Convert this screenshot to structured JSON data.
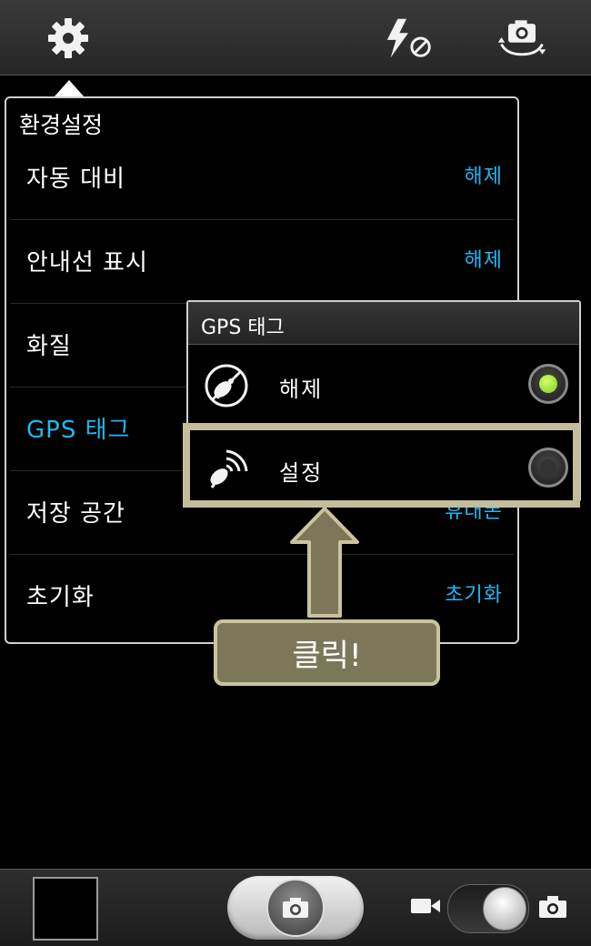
{
  "settings_menu": {
    "title": "환경설정",
    "rows": [
      {
        "label": "자동 대비",
        "value": "해제"
      },
      {
        "label": "안내선 표시",
        "value": "해제"
      },
      {
        "label": "화질",
        "value": ""
      },
      {
        "label": "GPS 태그",
        "value": ""
      },
      {
        "label": "저장 공간",
        "value": "휴대폰"
      },
      {
        "label": "초기화",
        "value": "초기화"
      }
    ]
  },
  "gps_popup": {
    "title": "GPS 태그",
    "options": [
      {
        "label": "해제",
        "selected": true
      },
      {
        "label": "설정",
        "selected": false
      }
    ]
  },
  "callout": {
    "text": "클릭!"
  },
  "icons": {
    "top": [
      "gear-icon",
      "flash-off-icon",
      "switch-camera-icon"
    ],
    "bottom": [
      "camera-icon",
      "video-camera-icon",
      "photo-camera-icon"
    ]
  },
  "colors": {
    "accent": "#1fb8f2",
    "radio_on": "#7ccf1c",
    "highlight": "#c3bd9c",
    "callout_bg": "#7d775a"
  }
}
